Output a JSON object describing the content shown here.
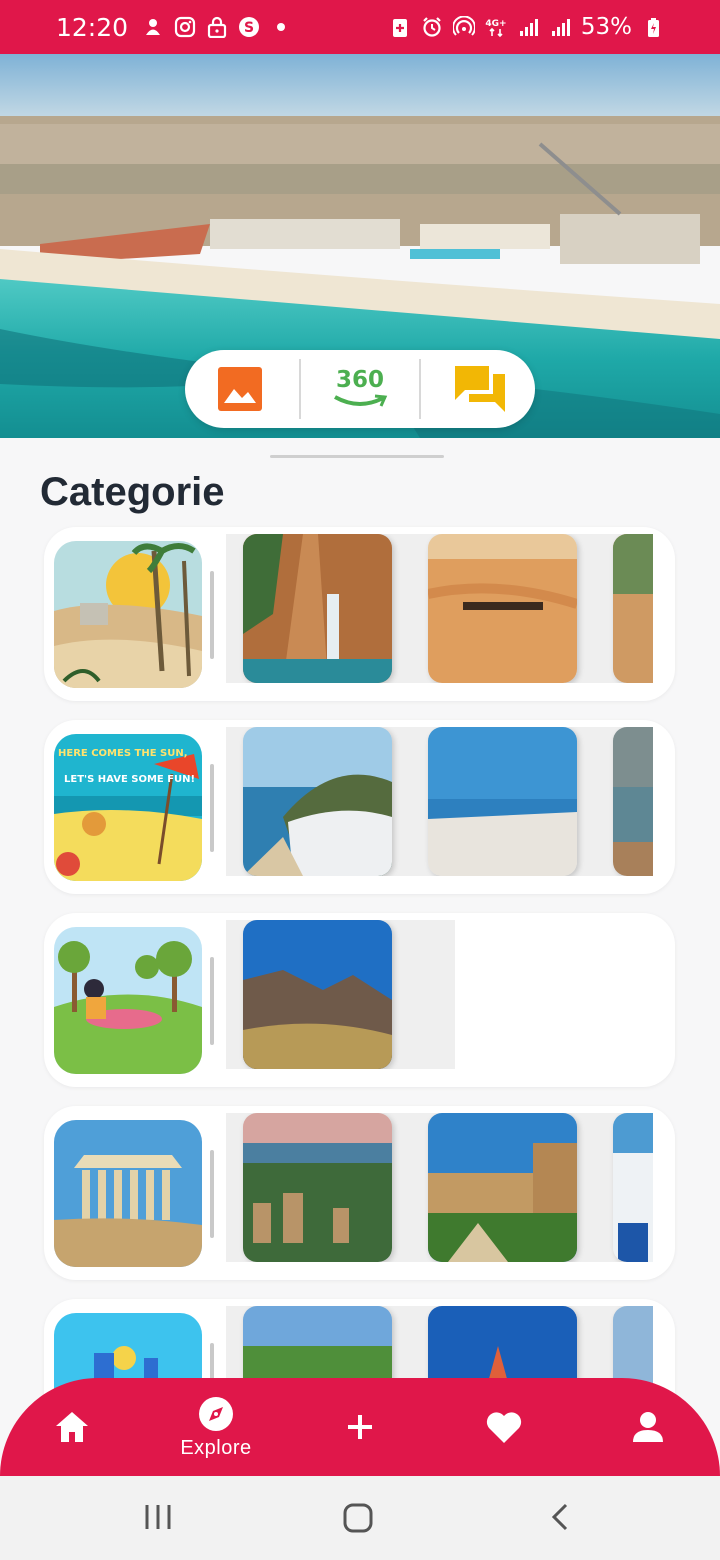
{
  "status_bar": {
    "time": "12:20",
    "battery": "53%",
    "left_icons": [
      "app-icon",
      "instagram-icon",
      "lock-icon",
      "s-app-icon",
      "dot-icon"
    ],
    "right_icons": [
      "battery-saver-icon",
      "alarm-icon",
      "hotspot-icon",
      "network-4g-icon",
      "signal-icon",
      "signal-icon",
      "battery-icon"
    ]
  },
  "hero": {
    "media_buttons": [
      {
        "name": "gallery",
        "icon": "image-icon",
        "color": "#f26b22"
      },
      {
        "name": "view-360",
        "label": "360",
        "icon": "rotate-360-icon",
        "color": "#4caf50"
      },
      {
        "name": "reviews",
        "icon": "chat-icon",
        "color": "#f2b705"
      }
    ]
  },
  "section": {
    "title": "Categorie"
  },
  "categories": [
    {
      "name": "desert",
      "photos": 3
    },
    {
      "name": "beach",
      "thumb_text": [
        "HERE COMES THE SUN,",
        "LET'S HAVE SOME FUN!"
      ],
      "photos": 3
    },
    {
      "name": "nature",
      "photos": 1
    },
    {
      "name": "historic",
      "photos": 3
    },
    {
      "name": "city",
      "photos": 3
    }
  ],
  "bottom_nav": {
    "items": [
      {
        "name": "home",
        "icon": "home-icon"
      },
      {
        "name": "explore",
        "icon": "compass-icon",
        "label": "Explore",
        "active": true
      },
      {
        "name": "add",
        "icon": "plus-icon"
      },
      {
        "name": "favorites",
        "icon": "heart-icon"
      },
      {
        "name": "profile",
        "icon": "person-icon"
      }
    ]
  },
  "system_nav": [
    "recents-icon",
    "home-button-icon",
    "back-icon"
  ],
  "colors": {
    "accent": "#e0174a",
    "title": "#222a35",
    "background": "#f7f7f8"
  }
}
